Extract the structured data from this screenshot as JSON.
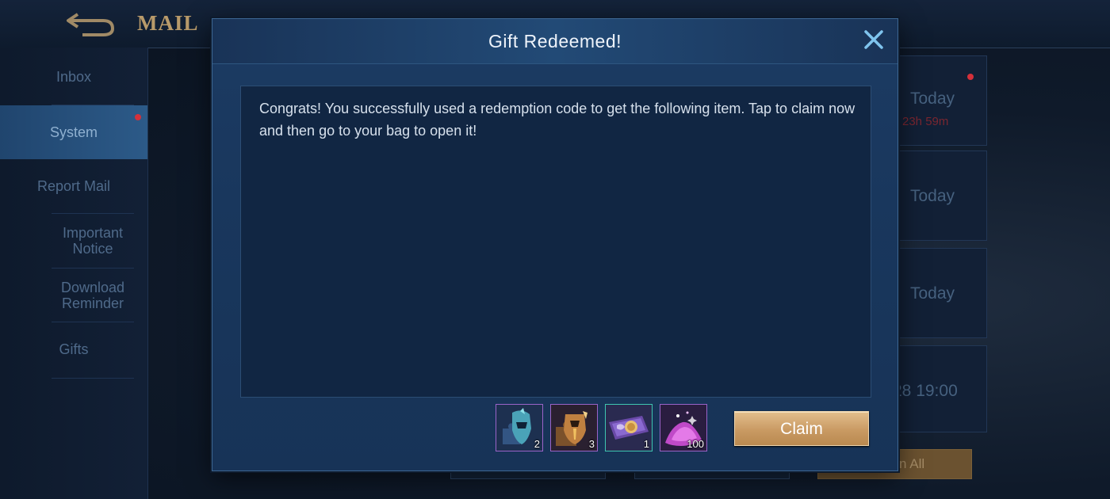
{
  "background": {
    "title": "MAIL",
    "sidebar": {
      "items": [
        {
          "label": "Inbox"
        },
        {
          "label": "System"
        },
        {
          "label": "Report Mail"
        },
        {
          "label": "Important Notice"
        },
        {
          "label": "Download Reminder"
        },
        {
          "label": "Gifts"
        }
      ]
    },
    "mails": [
      {
        "date": "Today",
        "expire": "23h 59m"
      },
      {
        "date": "Today"
      },
      {
        "date": "Today"
      },
      {
        "date": "28 19:00"
      }
    ],
    "bottom_buttons": {
      "claim_all_fragment": "n All"
    }
  },
  "modal": {
    "title": "Gift Redeemed!",
    "message": "Congrats! You successfully used a redemption code to get the following item. Tap to claim now and then go to your bag to open it!",
    "items": [
      {
        "icon": "hero-fragment-icon",
        "quantity": "2"
      },
      {
        "icon": "skin-fragment-icon",
        "quantity": "3"
      },
      {
        "icon": "trial-card-icon",
        "quantity": "1"
      },
      {
        "icon": "magic-dust-icon",
        "quantity": "100"
      }
    ],
    "claim_label": "Claim"
  },
  "colors": {
    "accent_gold": "#c99a63",
    "modal_blue": "#1c3b63",
    "notification_red": "#d4303a"
  }
}
